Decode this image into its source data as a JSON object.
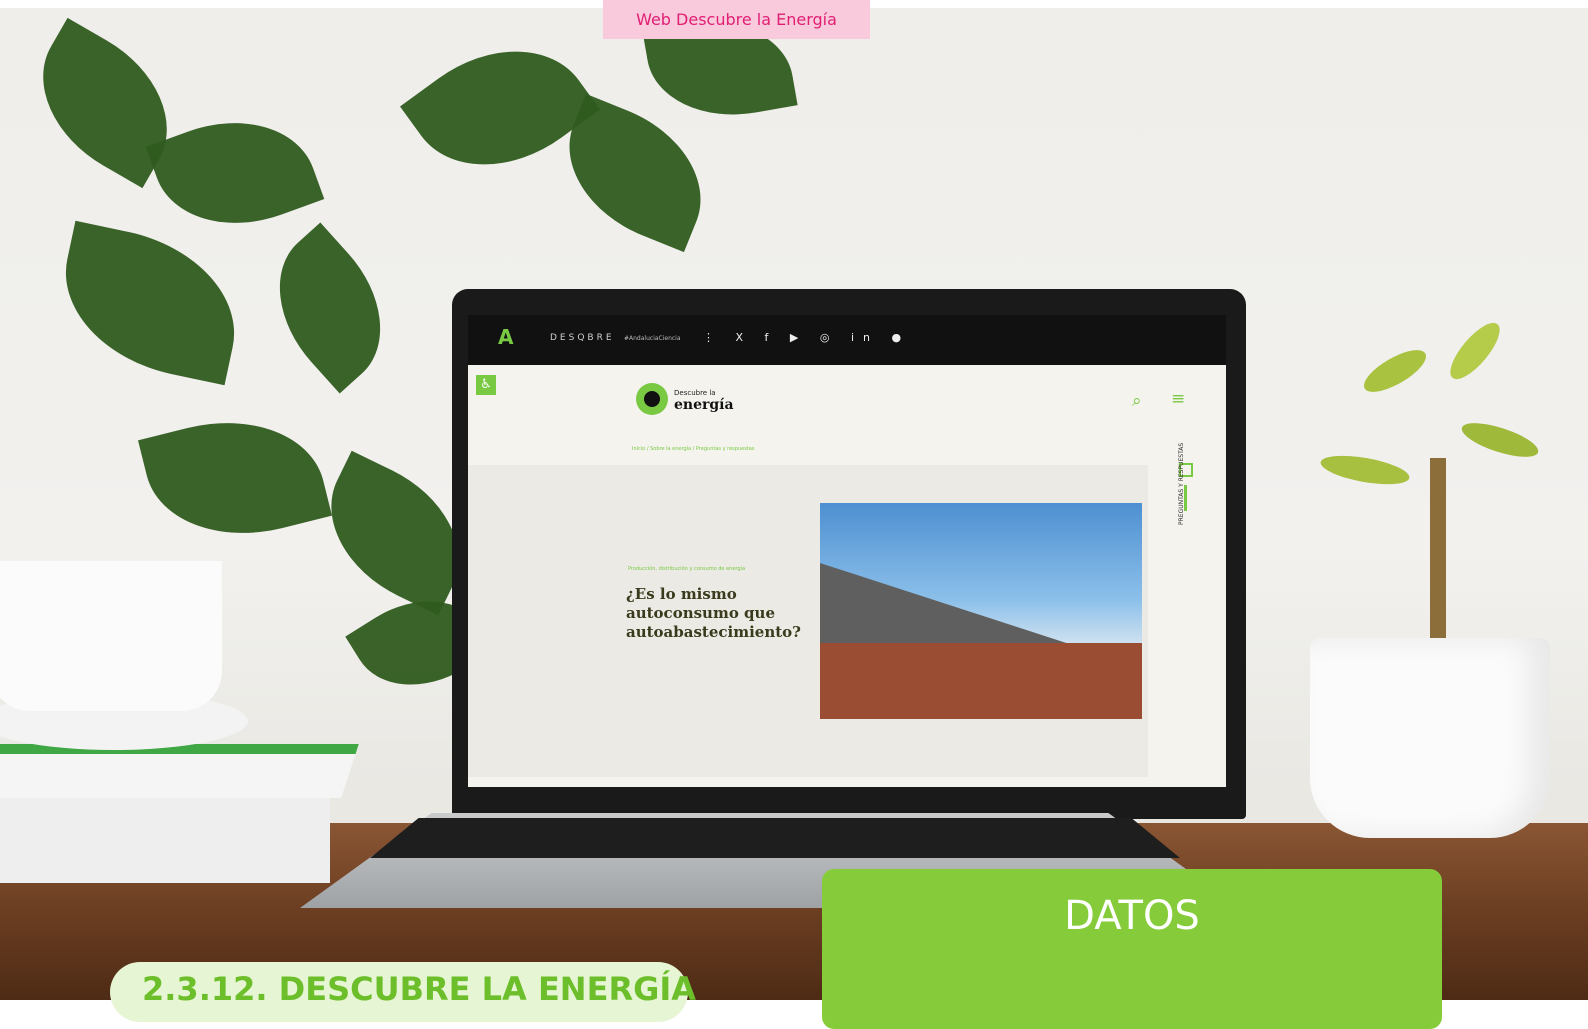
{
  "header_tab": "Web Descubre la Energía",
  "site_screen": {
    "brand_small": "Descubre la",
    "brand_big": "energía",
    "desq": "DESQBRE",
    "hashtag": "#AndaluciaCiencia",
    "social": "⋮ X f ▶ ◎ in ●",
    "breadcrumb": "Inicio / Sobre la energía / Preguntas y respuestas",
    "category": "Producción, distribución y consumo de energía",
    "question": "¿Es lo mismo autoconsumo que autoabastecimiento?",
    "sidebar_label": "PREGUNTAS Y RESPUESTAS"
  },
  "datos_label": "DATOS",
  "bottom_pill": "2.3.12. DESCUBRE LA ENERGÍA"
}
